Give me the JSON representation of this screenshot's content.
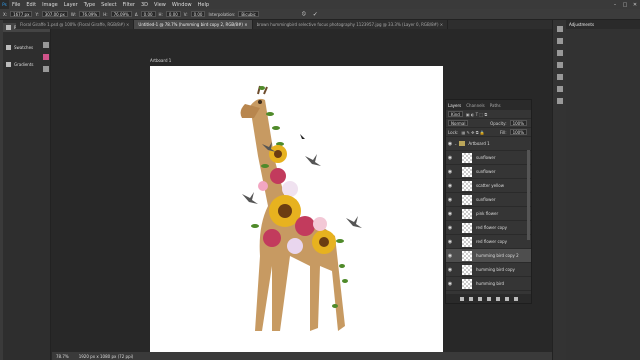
{
  "menu": {
    "logo": "Ps",
    "items": [
      "File",
      "Edit",
      "Image",
      "Layer",
      "Type",
      "Select",
      "Filter",
      "3D",
      "View",
      "Window",
      "Help"
    ],
    "win_controls": [
      "–",
      "□",
      "✕"
    ]
  },
  "options": {
    "x_label": "X:",
    "x_value": "1677 px",
    "y_label": "Y:",
    "y_value": "307.00 px",
    "w_label": "W:",
    "w_value": "76.09%",
    "h_label": "H:",
    "h_value": "76.09%",
    "angle_label": "Δ",
    "angle_value": "0.00",
    "hskew_label": "H:",
    "hskew_value": "0.00",
    "vskew_label": "V:",
    "vskew_value": "0.00",
    "interp_label": "Interpolation:",
    "interp_value": "Bicubic"
  },
  "tabs": [
    {
      "label": "Floral Giraffe 1.psd @ 100% (Floral Giraffe, RGB/8#) ×",
      "active": false
    },
    {
      "label": "Untitled-1 @ 78.7% (humming bird copy 2, RGB/8#) ×",
      "active": true
    },
    {
      "label": "brown hummingbird selective focus photography 1123957.jpg @ 33.3% (Layer 0, RGB/8#) ×",
      "active": false
    }
  ],
  "left_panel": {
    "items": [
      {
        "label": "Patterns",
        "selected": true
      },
      {
        "label": "Swatches",
        "selected": false
      },
      {
        "label": "Gradients",
        "selected": false
      }
    ]
  },
  "artboard_label": "Artboard 1",
  "status": {
    "zoom": "78.7%",
    "doc": "1920 px x 1080 px (72 ppi)"
  },
  "adjustments_label": "Adjustments",
  "layers_panel": {
    "tabs": [
      "Layers",
      "Channels",
      "Paths"
    ],
    "kind_label": "Kind",
    "blend_mode": "Normal",
    "opacity_label": "Opacity:",
    "opacity_value": "100%",
    "lock_label": "Lock:",
    "fill_label": "Fill:",
    "fill_value": "100%",
    "group_name": "Artboard 1",
    "layers": [
      {
        "name": "sunflower",
        "selected": false
      },
      {
        "name": "sunflower",
        "selected": false
      },
      {
        "name": "scatter yellow",
        "selected": false
      },
      {
        "name": "sunflower",
        "selected": false
      },
      {
        "name": "pink flower",
        "selected": false
      },
      {
        "name": "red flower copy",
        "selected": false
      },
      {
        "name": "red flower copy",
        "selected": false
      },
      {
        "name": "humming bird copy 2",
        "selected": true
      },
      {
        "name": "humming bird copy",
        "selected": false
      },
      {
        "name": "humming bird",
        "selected": false
      }
    ]
  }
}
